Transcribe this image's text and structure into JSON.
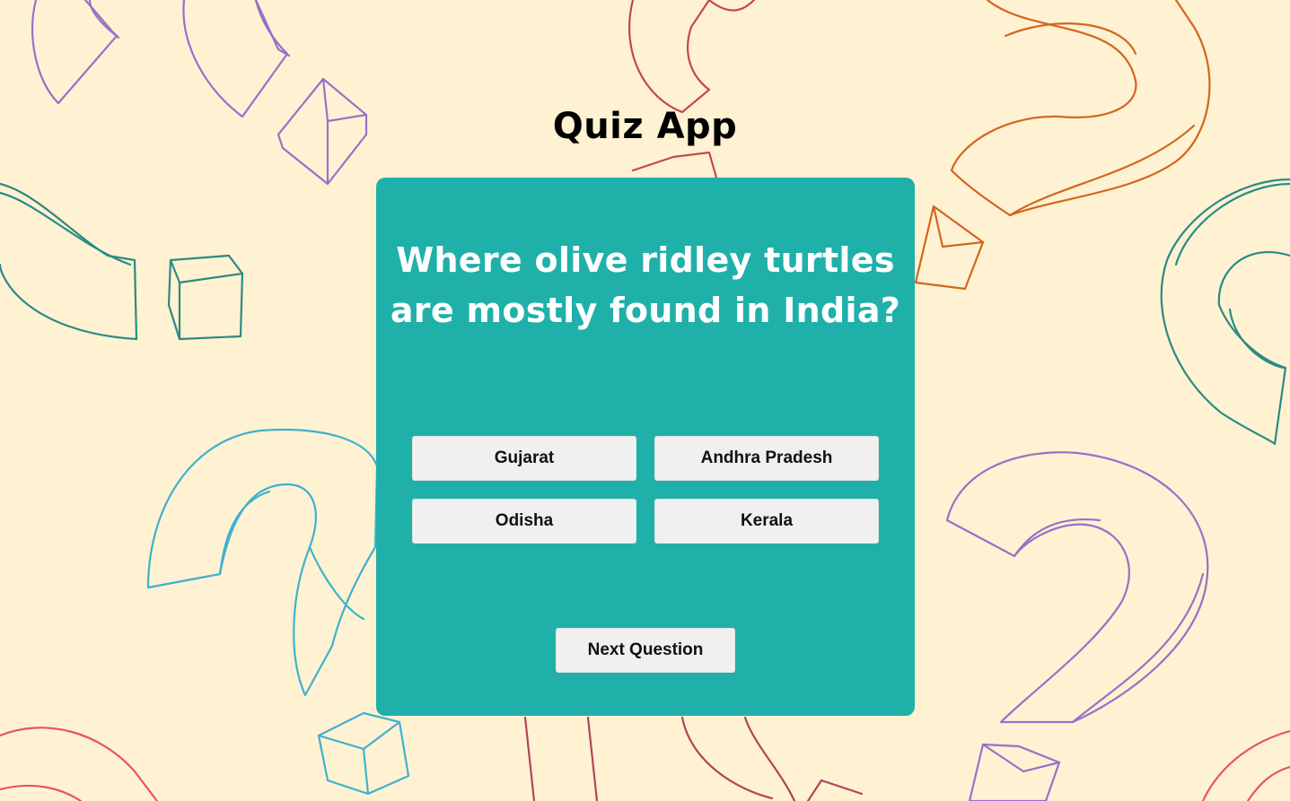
{
  "app": {
    "title": "Quiz App"
  },
  "quiz": {
    "question": "Where olive ridley turtles are mostly found in India?",
    "options": [
      "Gujarat",
      "Andhra Pradesh",
      "Odisha",
      "Kerala"
    ],
    "next_label": "Next Question"
  },
  "theme": {
    "background": "#fef2d2",
    "card": "#20b0aa",
    "button": "#f0f0f0",
    "doodle_colors": [
      "#9b6fc9",
      "#c8474a",
      "#d4651e",
      "#2a8a85",
      "#3fb1cf",
      "#e8555a"
    ]
  },
  "background_icons": [
    "question-mark-doodle-icon",
    "cube-doodle-icon"
  ]
}
